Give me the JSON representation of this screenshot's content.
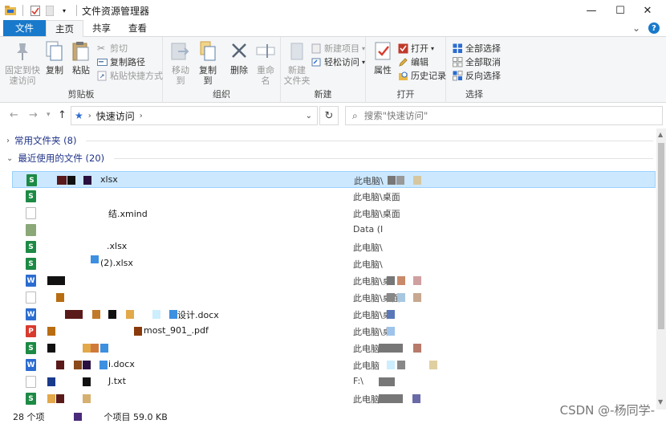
{
  "window": {
    "title": "文件资源管理器",
    "controls": {
      "minimize": "—",
      "maximize": "☐",
      "close": "✕"
    }
  },
  "ribbon_tabs": [
    "文件",
    "主页",
    "共享",
    "查看"
  ],
  "ribbon": {
    "clipboard": {
      "label": "剪贴板",
      "pin": "固定到快\n速访问",
      "copy": "复制",
      "paste": "粘贴",
      "cut": "剪切",
      "copy_path": "复制路径",
      "paste_shortcut": "粘贴快捷方式"
    },
    "organize": {
      "label": "组织",
      "move_to": "移动到",
      "copy_to": "复制到",
      "delete": "删除",
      "rename": "重命名"
    },
    "new": {
      "label": "新建",
      "new_folder": "新建\n文件夹",
      "new_item": "新建项目",
      "easy_access": "轻松访问"
    },
    "open": {
      "label": "打开",
      "properties": "属性",
      "open": "打开",
      "edit": "编辑",
      "history": "历史记录"
    },
    "select": {
      "label": "选择",
      "select_all": "全部选择",
      "select_none": "全部取消",
      "invert": "反向选择"
    }
  },
  "address": {
    "path": "快速访问",
    "search_placeholder": "搜索\"快速访问\""
  },
  "groups": {
    "frequent": "常用文件夹 (8)",
    "recent": "最近使用的文件 (20)"
  },
  "files": [
    {
      "name": "xlsx",
      "location": "此电脑\\",
      "type": "xlsx"
    },
    {
      "name": "",
      "location": "此电脑\\桌面",
      "type": "xlsx"
    },
    {
      "name": "结.xmind",
      "location": "此电脑\\桌面",
      "type": "xmind"
    },
    {
      "name": "",
      "location": "Data (I",
      "type": "img"
    },
    {
      "name": ".xlsx",
      "location": "此电脑\\",
      "type": "xlsx"
    },
    {
      "name": "(2).xlsx",
      "location": "此电脑\\",
      "type": "xlsx"
    },
    {
      "name": "",
      "location": "此电脑\\桌",
      "type": "docx"
    },
    {
      "name": "",
      "location": "此电脑\\桌面",
      "type": "img"
    },
    {
      "name": "设计.docx",
      "location": "此电脑\\桌",
      "type": "docx"
    },
    {
      "name": "most_901_.pdf",
      "location": "此电脑\\桌",
      "type": "pdf"
    },
    {
      "name": "",
      "location": "此电脑\\",
      "type": "xlsx"
    },
    {
      "name": "i.docx",
      "location": "此电脑",
      "type": "docx"
    },
    {
      "name": "J.txt",
      "location": "F:\\",
      "type": "txt"
    },
    {
      "name": "",
      "location": "此电脑\\",
      "type": "xlsx"
    }
  ],
  "status": {
    "count": "28 个项",
    "selected": "个项目 59.0 KB"
  },
  "watermark": "CSDN @-杨同学-",
  "colors": {
    "accent": "#1979ca",
    "selection": "#cce8ff",
    "xlsx": "#1d8a45",
    "docx": "#2b6cd1",
    "pdf": "#d83b2d"
  }
}
